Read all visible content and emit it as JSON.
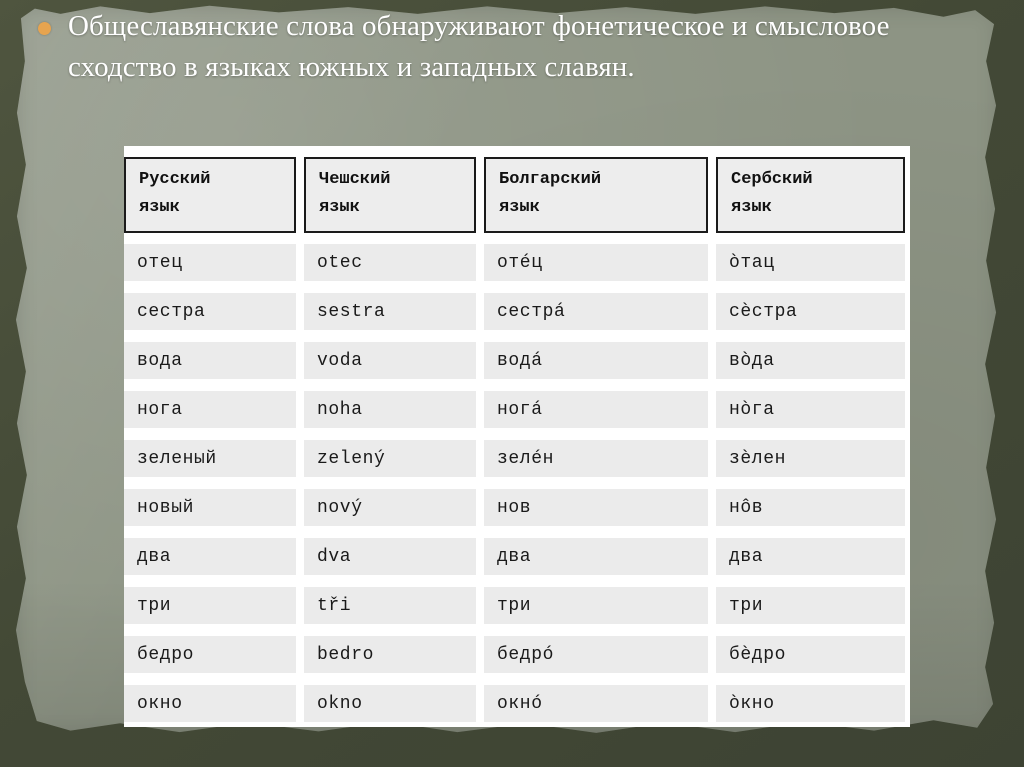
{
  "slide": {
    "bullet_icon": "bullet-dot-icon",
    "headline": "Общеславянские слова обнаруживают фонетическое и смысловое сходство в языках южных и западных славян.",
    "colors": {
      "backdrop": "#464c3c",
      "paper": "#8d9484",
      "bullet": "#e7a44f",
      "headline_text": "#ffffff",
      "table_background": "#ffffff",
      "cell_fill": "#ebebeb",
      "header_fill": "#ededed",
      "header_border": "#1b1b1b",
      "cell_text": "#1a1a1a"
    }
  },
  "table": {
    "headers": [
      "Русский\nязык",
      "Чешский\nязык",
      "Болгарский\nязык",
      "Сербский\nязык"
    ],
    "headers_line1": [
      "Русский",
      "Чешский",
      "Болгарский",
      "Сербский"
    ],
    "headers_line2": [
      "язык",
      "язык",
      "язык",
      "язык"
    ],
    "rows": [
      [
        "отец",
        "otec",
        "отéц",
        "òтац"
      ],
      [
        "сестра",
        "sestra",
        "сестрá",
        "сèстра"
      ],
      [
        "вода",
        "voda",
        "водá",
        "вòда"
      ],
      [
        "нога",
        "noha",
        "ногá",
        "нòга"
      ],
      [
        "зеленый",
        "zelený",
        "зелéн",
        "зèлен"
      ],
      [
        "новый",
        "nový",
        "нов",
        "нôв"
      ],
      [
        "два",
        "dva",
        "два",
        "два"
      ],
      [
        "три",
        "tři",
        "три",
        "три"
      ],
      [
        "бедро",
        "bedro",
        "бедрó",
        "бèдро"
      ],
      [
        "окно",
        "okno",
        "окнó",
        "òкно"
      ]
    ]
  }
}
